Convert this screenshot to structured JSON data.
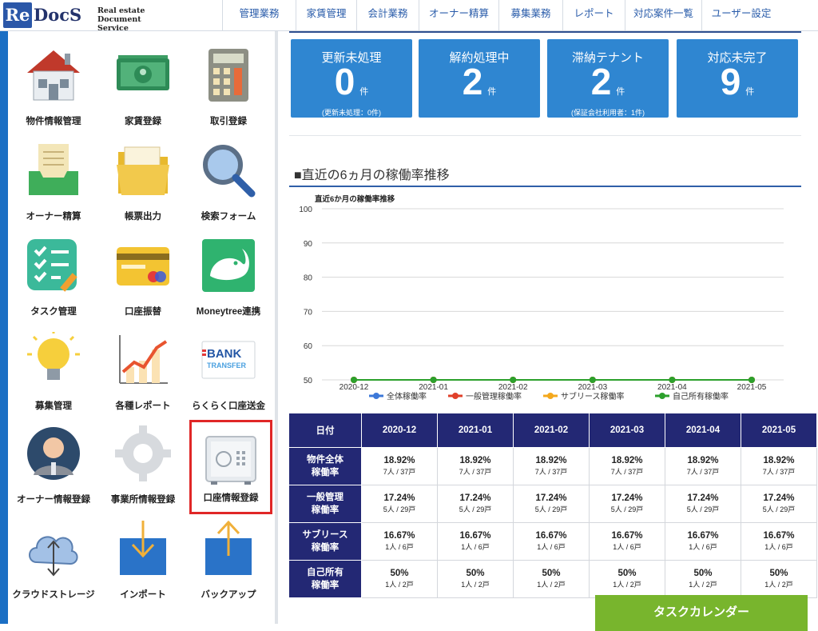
{
  "header": {
    "logo": {
      "re": "Re",
      "docs": "DocS",
      "sub1": "Real estate",
      "sub2": "Document Service"
    },
    "nav": [
      {
        "label": "管理業務",
        "w": 92
      },
      {
        "label": "家賃管理",
        "w": 76
      },
      {
        "label": "会計業務",
        "w": 78
      },
      {
        "label": "オーナー精算",
        "w": 100
      },
      {
        "label": "募集業務",
        "w": 80
      },
      {
        "label": "レポート",
        "w": 78
      },
      {
        "label": "対応案件一覧",
        "w": 96
      },
      {
        "label": "ユーザー設定",
        "w": 99
      }
    ]
  },
  "sidebar": {
    "tiles": [
      {
        "label": "物件情報管理",
        "icon": "house-icon"
      },
      {
        "label": "家賃登録",
        "icon": "banknote-icon"
      },
      {
        "label": "取引登録",
        "icon": "calculator-icon"
      },
      {
        "label": "オーナー精算",
        "icon": "inbox-tray-icon"
      },
      {
        "label": "帳票出力",
        "icon": "folder-icon"
      },
      {
        "label": "検索フォーム",
        "icon": "magnifier-icon"
      },
      {
        "label": "タスク管理",
        "icon": "checklist-icon"
      },
      {
        "label": "口座振替",
        "icon": "credit-card-icon"
      },
      {
        "label": "Moneytree連携",
        "icon": "moneytree-elephant-icon"
      },
      {
        "label": "募集管理",
        "icon": "light-bulb-icon"
      },
      {
        "label": "各種レポート",
        "icon": "growth-chart-icon"
      },
      {
        "label": "らくらく口座送金",
        "icon": "bank-transfer-icon"
      },
      {
        "label": "オーナー情報登録",
        "icon": "owner-avatar-icon"
      },
      {
        "label": "事業所情報登録",
        "icon": "gear-icon"
      },
      {
        "label": "口座情報登録",
        "icon": "safe-icon",
        "selected": true
      },
      {
        "label": "クラウドストレージ",
        "icon": "cloud-icon"
      },
      {
        "label": "インポート",
        "icon": "import-icon"
      },
      {
        "label": "バックアップ",
        "icon": "backup-icon"
      }
    ],
    "bank_icon_text": {
      "top": "BANK",
      "bottom": "TRANSFER"
    }
  },
  "stats": [
    {
      "title": "更新未処理",
      "value": "0",
      "unit": "件",
      "note": "(更新未処理：0件)"
    },
    {
      "title": "解約処理中",
      "value": "2",
      "unit": "件",
      "note": ""
    },
    {
      "title": "滞納テナント",
      "value": "2",
      "unit": "件",
      "note": "(保証会社利用者：1件)"
    },
    {
      "title": "対応未完了",
      "value": "9",
      "unit": "件",
      "note": ""
    }
  ],
  "section_title": "■直近の6ヵ月の稼働率推移",
  "chart_data": {
    "type": "line",
    "title": "直近6か月の稼働率推移",
    "categories": [
      "2020-12",
      "2021-01",
      "2021-02",
      "2021-03",
      "2021-04",
      "2021-05"
    ],
    "yticks": [
      50,
      60,
      70,
      80,
      90,
      100
    ],
    "ylim": [
      50,
      100
    ],
    "grid": true,
    "legend_position": "bottom",
    "series": [
      {
        "name": "全体稼働率",
        "color": "#3c78d8",
        "values": [
          18.92,
          18.92,
          18.92,
          18.92,
          18.92,
          18.92
        ]
      },
      {
        "name": "一般管理稼働率",
        "color": "#e0402a",
        "values": [
          17.24,
          17.24,
          17.24,
          17.24,
          17.24,
          17.24
        ]
      },
      {
        "name": "サブリース稼働率",
        "color": "#f4a81d",
        "values": [
          16.67,
          16.67,
          16.67,
          16.67,
          16.67,
          16.67
        ]
      },
      {
        "name": "自己所有稼働率",
        "color": "#2ca02c",
        "values": [
          50,
          50,
          50,
          50,
          50,
          50
        ]
      }
    ]
  },
  "table": {
    "header": [
      "日付",
      "2020-12",
      "2021-01",
      "2021-02",
      "2021-03",
      "2021-04",
      "2021-05"
    ],
    "rows": [
      {
        "label1": "物件全体",
        "label2": "稼働率",
        "cells": [
          [
            "18.92%",
            "7人 / 37戸"
          ],
          [
            "18.92%",
            "7人 / 37戸"
          ],
          [
            "18.92%",
            "7人 / 37戸"
          ],
          [
            "18.92%",
            "7人 / 37戸"
          ],
          [
            "18.92%",
            "7人 / 37戸"
          ],
          [
            "18.92%",
            "7人 / 37戸"
          ]
        ]
      },
      {
        "label1": "一般管理",
        "label2": "稼働率",
        "cells": [
          [
            "17.24%",
            "5人 / 29戸"
          ],
          [
            "17.24%",
            "5人 / 29戸"
          ],
          [
            "17.24%",
            "5人 / 29戸"
          ],
          [
            "17.24%",
            "5人 / 29戸"
          ],
          [
            "17.24%",
            "5人 / 29戸"
          ],
          [
            "17.24%",
            "5人 / 29戸"
          ]
        ]
      },
      {
        "label1": "サブリース",
        "label2": "稼働率",
        "cells": [
          [
            "16.67%",
            "1人 / 6戸"
          ],
          [
            "16.67%",
            "1人 / 6戸"
          ],
          [
            "16.67%",
            "1人 / 6戸"
          ],
          [
            "16.67%",
            "1人 / 6戸"
          ],
          [
            "16.67%",
            "1人 / 6戸"
          ],
          [
            "16.67%",
            "1人 / 6戸"
          ]
        ]
      },
      {
        "label1": "自己所有",
        "label2": "稼働率",
        "cells": [
          [
            "50%",
            "1人 / 2戸"
          ],
          [
            "50%",
            "1人 / 2戸"
          ],
          [
            "50%",
            "1人 / 2戸"
          ],
          [
            "50%",
            "1人 / 2戸"
          ],
          [
            "50%",
            "1人 / 2戸"
          ],
          [
            "50%",
            "1人 / 2戸"
          ]
        ]
      }
    ]
  },
  "calendar_button": "タスクカレンダー"
}
